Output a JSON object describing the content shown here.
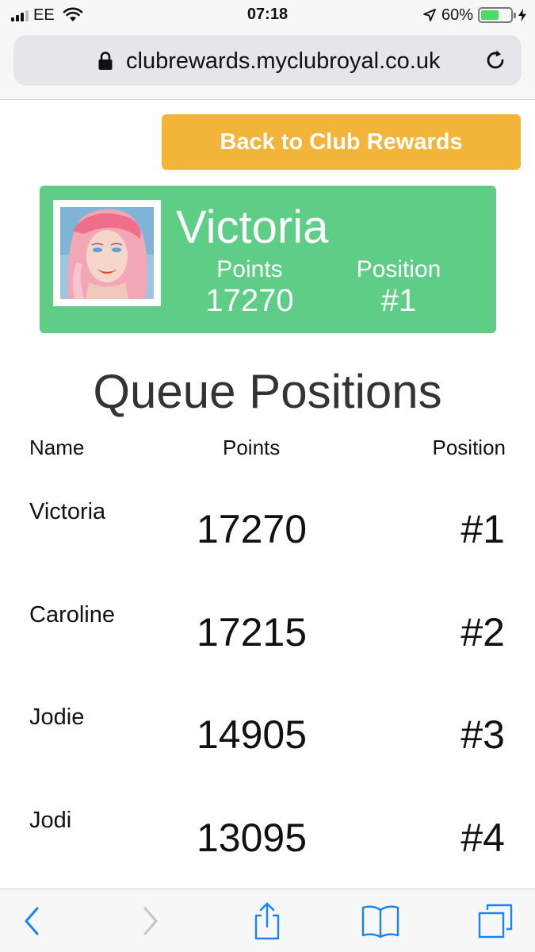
{
  "status_bar": {
    "carrier": "EE",
    "time": "07:18",
    "battery_percent": "60%",
    "battery_level": 0.6,
    "icons": [
      "signal-icon",
      "wifi-icon",
      "location-arrow-icon",
      "battery-icon",
      "charging-bolt-icon"
    ]
  },
  "browser": {
    "url": "clubrewards.myclubroyal.co.uk",
    "icons": [
      "lock-icon",
      "reload-icon"
    ]
  },
  "back_button": {
    "label": "Back to Club Rewards"
  },
  "profile": {
    "name": "Victoria",
    "points_label": "Points",
    "points_value": "17270",
    "position_label": "Position",
    "position_value": "#1"
  },
  "queue": {
    "title": "Queue Positions",
    "columns": [
      "Name",
      "Points",
      "Position"
    ],
    "rows": [
      {
        "name": "Victoria",
        "points": "17270",
        "position": "#1"
      },
      {
        "name": "Caroline",
        "points": "17215",
        "position": "#2"
      },
      {
        "name": "Jodie",
        "points": "14905",
        "position": "#3"
      },
      {
        "name": "Jodi",
        "points": "13095",
        "position": "#4"
      }
    ]
  },
  "toolbar": {
    "icons": [
      "back-arrow-icon",
      "forward-arrow-icon",
      "share-icon",
      "bookmarks-icon",
      "tabs-icon"
    ]
  },
  "colors": {
    "accent_button": "#f2b53a",
    "profile_card": "#5ecd86",
    "ios_blue": "#1a82fb"
  }
}
